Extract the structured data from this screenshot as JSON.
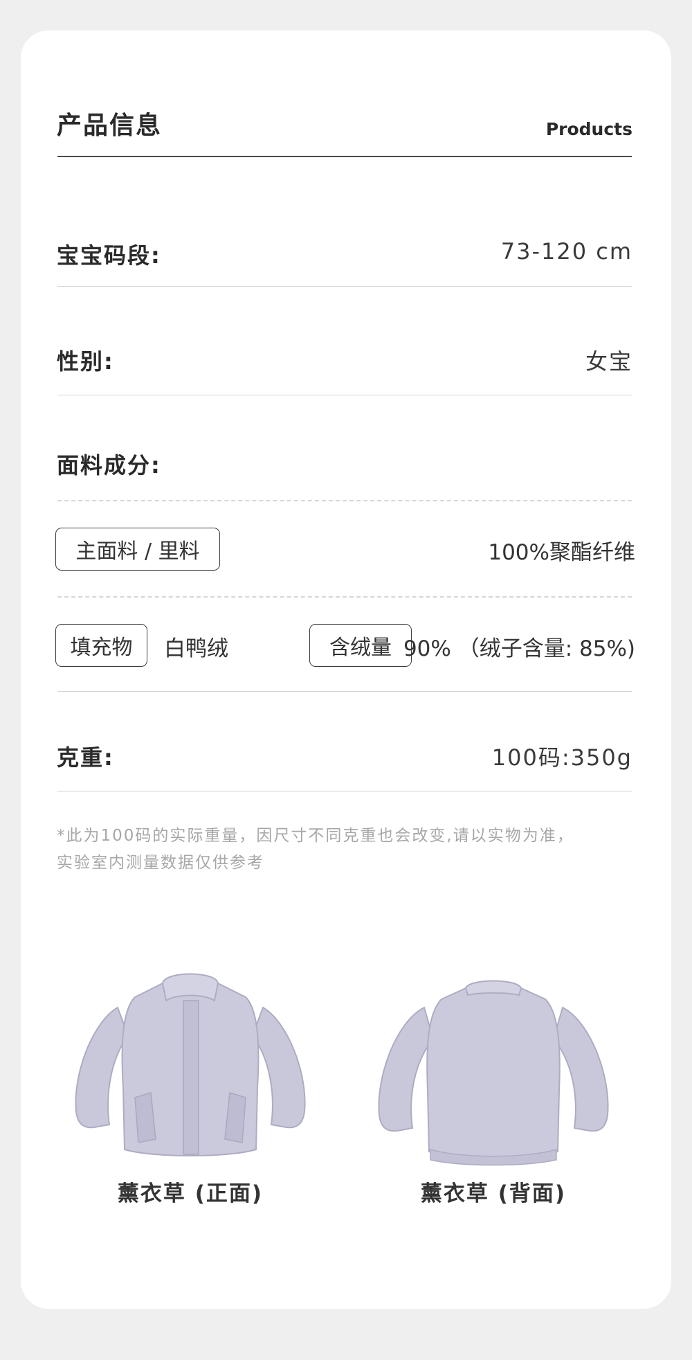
{
  "header": {
    "title": "产品信息",
    "title_en": "Products"
  },
  "rows": {
    "size": {
      "label": "宝宝码段:",
      "value": "73-120 cm"
    },
    "gender": {
      "label": "性别:",
      "value": "女宝"
    },
    "fabric": {
      "label": "面料成分:",
      "main_tag": "主面料 / 里料",
      "main_value": "100%聚酯纤维",
      "fill_tag": "填充物",
      "fill_value": "白鸭绒",
      "down_tag": "含绒量",
      "down_value": "90% （绒子含量: 85%)"
    },
    "weight": {
      "label": "克重:",
      "value": "100码:350g"
    }
  },
  "note": {
    "line1": "*此为100码的实际重量，因尺寸不同克重也会改变,请以实物为准，",
    "line2": "实验室内测量数据仅供参考"
  },
  "products": [
    {
      "name": "薰衣草 (正面)",
      "icon": "jacket-front-image"
    },
    {
      "name": "薰衣草 (背面)",
      "icon": "jacket-back-image"
    }
  ],
  "colors": {
    "jacket": "#c7c6da",
    "jacket_shadow": "#a9a8c0",
    "background": "#efefef"
  }
}
